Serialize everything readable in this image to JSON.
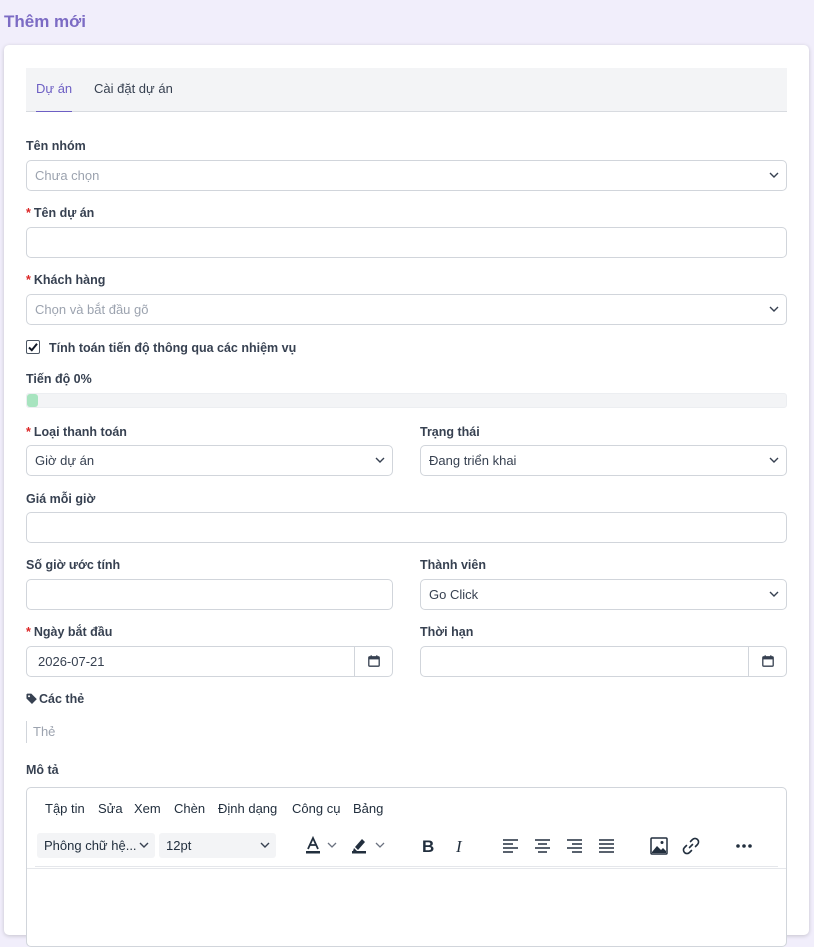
{
  "page": {
    "title": "Thêm mới"
  },
  "tabs": [
    {
      "label": "Dự án",
      "active": true
    },
    {
      "label": "Cài đặt dự án",
      "active": false
    }
  ],
  "form": {
    "required_mark": "*",
    "group": {
      "label": "Tên nhóm",
      "placeholder": "Chưa chọn"
    },
    "project_name": {
      "label": "Tên dự án",
      "value": ""
    },
    "customer": {
      "label": "Khách hàng",
      "placeholder": "Chọn và bắt đầu gõ"
    },
    "calc_progress": {
      "label": "Tính toán tiến độ thông qua các nhiệm vụ",
      "checked": true
    },
    "progress": {
      "label": "Tiến độ 0%",
      "value_percent": 0,
      "fill_color": "#a7e4bf"
    },
    "billing_type": {
      "label": "Loại thanh toán",
      "value": "Giờ dự án"
    },
    "status": {
      "label": "Trạng thái",
      "value": "Đang triển khai"
    },
    "rate_per_hour": {
      "label": "Giá mỗi giờ",
      "value": ""
    },
    "estimated_hours": {
      "label": "Số giờ ước tính",
      "value": ""
    },
    "members": {
      "label": "Thành viên",
      "value": "Go Click"
    },
    "start_date": {
      "label": "Ngày bắt đầu",
      "value": "2026-07-21"
    },
    "deadline": {
      "label": "Thời hạn",
      "value": ""
    },
    "tags": {
      "label": "Các thẻ",
      "placeholder": "Thẻ"
    },
    "description": {
      "label": "Mô tả"
    }
  },
  "editor": {
    "menu": [
      "Tập tin",
      "Sửa",
      "Xem",
      "Chèn",
      "Định dạng",
      "Công cụ",
      "Bảng"
    ],
    "font_family": "Phông chữ hệ...",
    "font_size": "12pt",
    "toolbar_icons": [
      "text-color-icon",
      "highlight-icon",
      "bold-icon",
      "italic-icon",
      "align-left-icon",
      "align-center-icon",
      "align-right-icon",
      "align-justify-icon",
      "image-icon",
      "link-icon",
      "more-icon"
    ]
  },
  "colors": {
    "accent": "#6d5fc4",
    "title": "#7c6bc4",
    "required": "#dc2626",
    "background": "#f1eefb"
  }
}
